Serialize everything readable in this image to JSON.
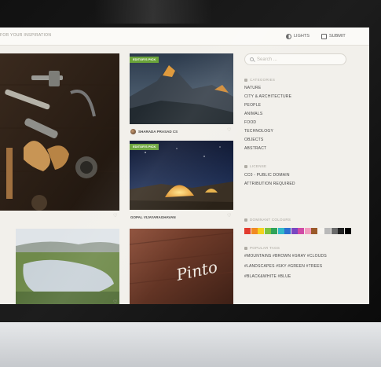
{
  "topbar": {
    "tagline": "FOR YOUR INSPIRATION",
    "lights_label": "LIGHTS",
    "submit_label": "SUBMIT"
  },
  "cards": [
    {
      "badge": "",
      "author": "",
      "photo_icon": "tools-photo"
    },
    {
      "badge": "EDITOR'S PICK",
      "author": "SHARADA PRASAD CS",
      "photo_icon": "mountain-photo"
    },
    {
      "badge": "EDITOR'S PICK",
      "author": "GOPAL VIJAYARAGHAVAN",
      "photo_icon": "tent-photo"
    },
    {
      "badge": "",
      "author": "",
      "photo_icon": "lake-photo"
    },
    {
      "badge": "",
      "author": "",
      "photo_icon": "wood-sign-photo",
      "sign_text": "Pinto"
    }
  ],
  "sidebar": {
    "search_placeholder": "Search ...",
    "categories_heading": "CATEGORIES",
    "categories": [
      "NATURE",
      "CITY & ARCHITECTURE",
      "PEOPLE",
      "ANIMALS",
      "FOOD",
      "TECHNOLOGY",
      "OBJECTS",
      "ABSTRACT"
    ],
    "license_heading": "LICENSE",
    "licenses": [
      "CC0 - PUBLIC DOMAIN",
      "ATTRIBUTION REQUIRED"
    ],
    "colours_heading": "DOMINANT COLOURS",
    "colours": [
      "#e23b2e",
      "#f08a24",
      "#f3d21e",
      "#7cc242",
      "#2fa35a",
      "#33b8c9",
      "#2f6fd0",
      "#7a47c1",
      "#d04ba6",
      "#f19cbf",
      "#9a5a2a",
      "#f6f4ef",
      "#b9b9b9",
      "#6b6b6b",
      "#222222",
      "#000000"
    ],
    "tags_heading": "POPULAR TAGS",
    "tags": [
      "#MOUNTAINS",
      "#BROWN",
      "#GRAY",
      "#CLOUDS",
      "#LANDSCAPES",
      "#SKY",
      "#GREEN",
      "#TREES",
      "#BLACK&WHITE",
      "#BLUE"
    ]
  }
}
